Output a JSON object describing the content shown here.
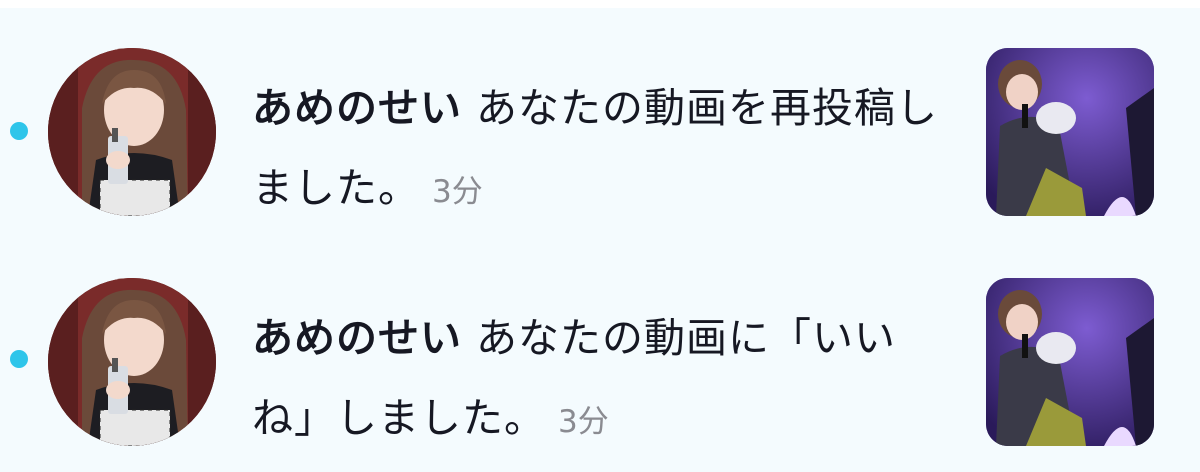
{
  "notifications": [
    {
      "unread": true,
      "username": "あめのせい",
      "action": " あなたの動画を再投稿しました。",
      "time": "3分",
      "avatar_icon": "user-avatar",
      "thumbnail_icon": "video-thumbnail"
    },
    {
      "unread": true,
      "username": "あめのせい",
      "action": " あなたの動画に「いいね」しました。",
      "time": "3分",
      "avatar_icon": "user-avatar",
      "thumbnail_icon": "video-thumbnail"
    }
  ],
  "colors": {
    "background": "#f4fbfe",
    "unread_dot": "#2ec5ea",
    "text": "#161823",
    "time": "#8a8b91"
  }
}
